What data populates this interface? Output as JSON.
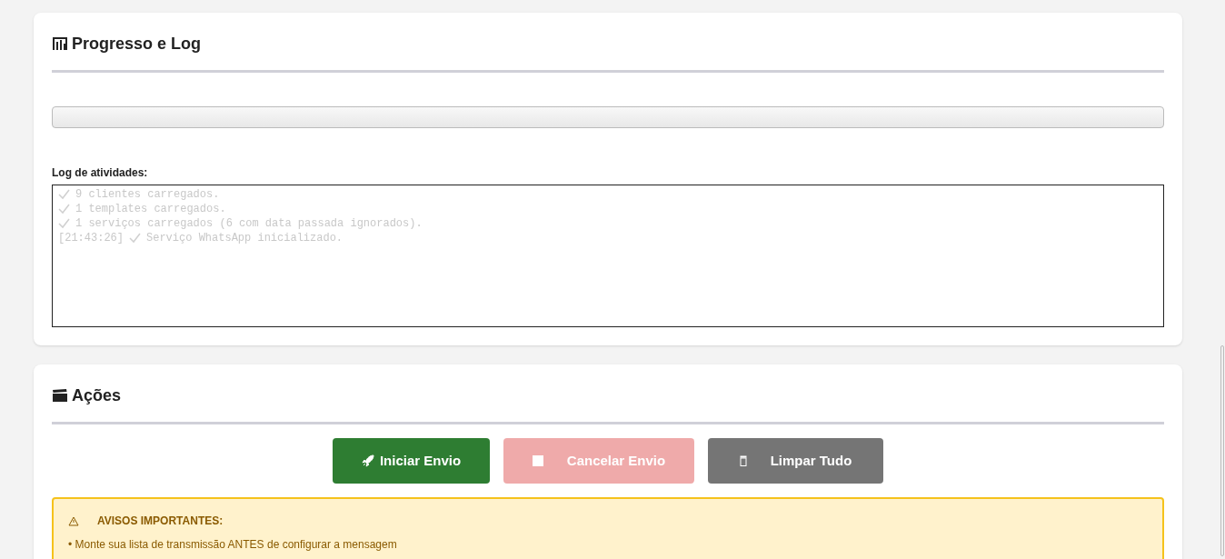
{
  "progress_panel": {
    "title": "Progresso e Log",
    "progress": {
      "level": 0
    },
    "log_label": "Log de atividades:",
    "log_lines": [
      {
        "check": true,
        "text": "9 clientes carregados."
      },
      {
        "check": true,
        "text": "1 templates carregados."
      },
      {
        "check": true,
        "text": "1 serviços carregados (6 com data passada ignorados)."
      },
      {
        "time": "[21:43:26]",
        "check": true,
        "text": "Serviço WhatsApp inicializado."
      }
    ]
  },
  "actions_panel": {
    "title": "Ações",
    "buttons": [
      {
        "kind": "start",
        "label": "Iniciar Envio",
        "disabled": false
      },
      {
        "kind": "cancel",
        "label": "Cancelar Envio",
        "disabled": true
      },
      {
        "kind": "clear",
        "label": "Limpar Tudo",
        "disabled": false
      }
    ],
    "warnings": {
      "title": "AVISOS IMPORTANTES:",
      "items": [
        "• Monte sua lista de transmissão ANTES de configurar a mensagem"
      ]
    }
  }
}
